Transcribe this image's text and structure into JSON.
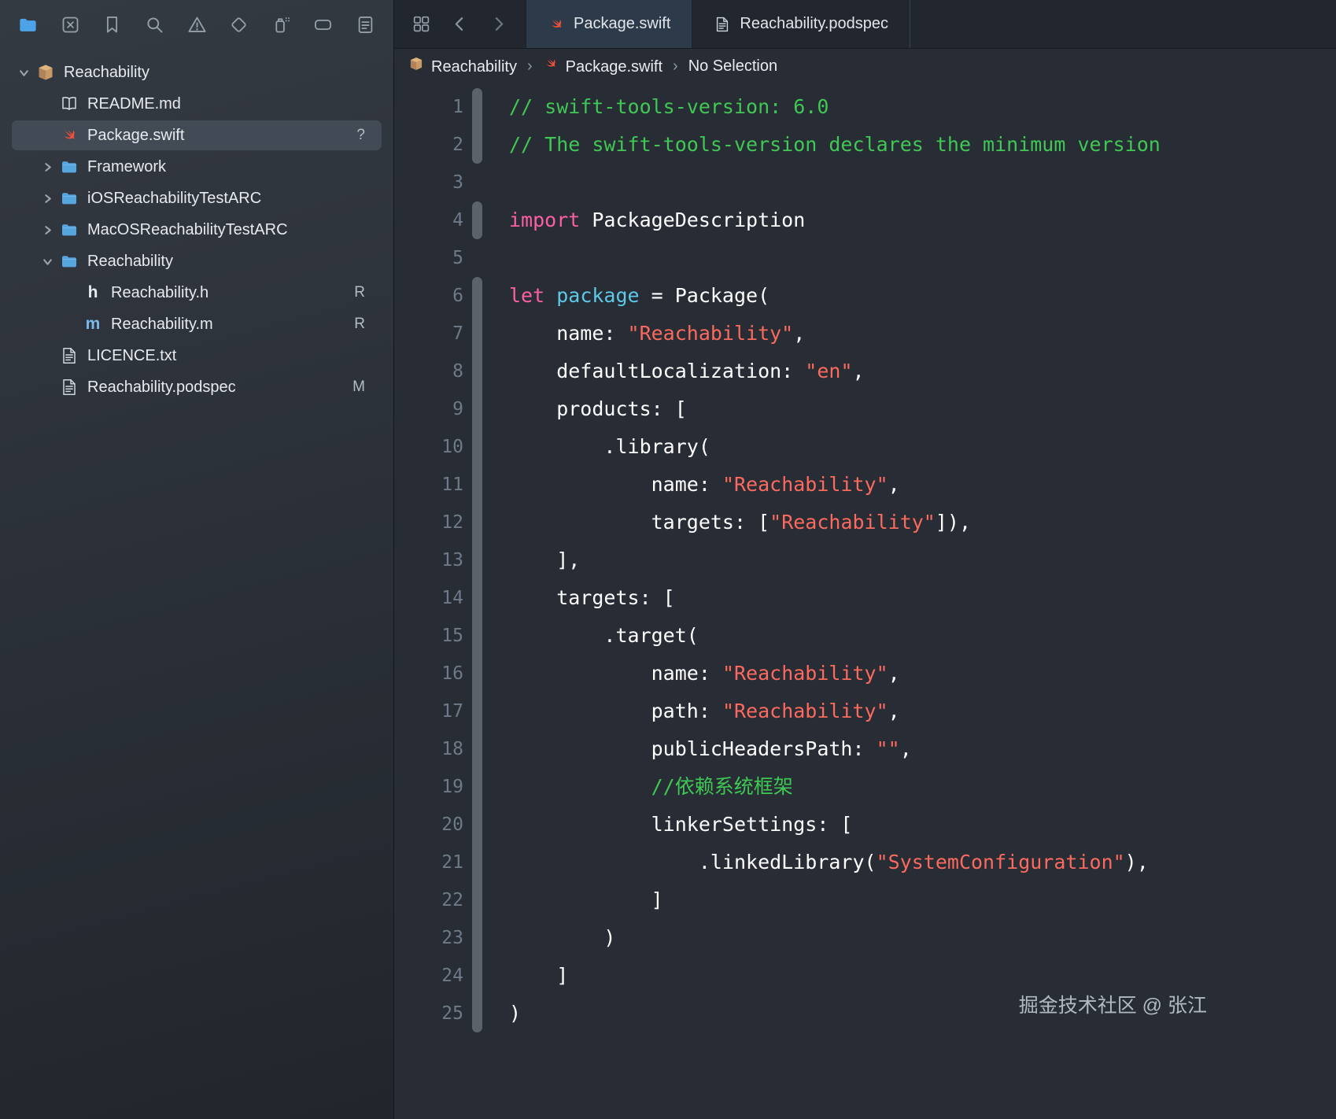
{
  "theme": {
    "editor_bg": "#272c35",
    "sidebar_bg": "#2c3139",
    "accent_blue": "#4da3e8",
    "selected_row": "#424a56",
    "comment_color": "#3fc854",
    "keyword_color": "#fc5fa3",
    "string_color": "#fc6a5d",
    "variable_color": "#5dc9e8",
    "swift_orange": "#f0513a"
  },
  "sidebar": {
    "toolbar": [
      {
        "name": "project-navigator",
        "icon": "folder-fill",
        "active": true
      },
      {
        "name": "source-control-navigator",
        "icon": "square-x",
        "active": false
      },
      {
        "name": "bookmarks-navigator",
        "icon": "bookmark",
        "active": false
      },
      {
        "name": "find-navigator",
        "icon": "magnifier",
        "active": false
      },
      {
        "name": "issues-navigator",
        "icon": "warning",
        "active": false
      },
      {
        "name": "tests-navigator",
        "icon": "diamond",
        "active": false
      },
      {
        "name": "debug-navigator",
        "icon": "spray",
        "active": false
      },
      {
        "name": "breakpoints-navigator",
        "icon": "flag",
        "active": false
      },
      {
        "name": "reports-navigator",
        "icon": "report",
        "active": false
      }
    ],
    "tree": [
      {
        "label": "Reachability",
        "icon": "package",
        "indent": 0,
        "chevron": "down",
        "badge": null,
        "selected": false
      },
      {
        "label": "README.md",
        "icon": "book",
        "indent": 1,
        "chevron": null,
        "badge": null,
        "selected": false
      },
      {
        "label": "Package.swift",
        "icon": "swift",
        "indent": 1,
        "chevron": null,
        "badge": "?",
        "selected": true
      },
      {
        "label": "Framework",
        "icon": "folder",
        "indent": 1,
        "chevron": "right",
        "badge": null,
        "selected": false
      },
      {
        "label": "iOSReachabilityTestARC",
        "icon": "folder",
        "indent": 1,
        "chevron": "right",
        "badge": null,
        "selected": false
      },
      {
        "label": "MacOSReachabilityTestARC",
        "icon": "folder",
        "indent": 1,
        "chevron": "right",
        "badge": null,
        "selected": false
      },
      {
        "label": "Reachability",
        "icon": "folder",
        "indent": 1,
        "chevron": "down",
        "badge": null,
        "selected": false
      },
      {
        "label": "Reachability.h",
        "icon": "file-h",
        "indent": 2,
        "chevron": null,
        "badge": "R",
        "selected": false
      },
      {
        "label": "Reachability.m",
        "icon": "file-m",
        "indent": 2,
        "chevron": null,
        "badge": "R",
        "selected": false
      },
      {
        "label": "LICENCE.txt",
        "icon": "doc",
        "indent": 1,
        "chevron": null,
        "badge": null,
        "selected": false
      },
      {
        "label": "Reachability.podspec",
        "icon": "doc",
        "indent": 1,
        "chevron": null,
        "badge": "M",
        "selected": false
      }
    ]
  },
  "editor": {
    "tabs": [
      {
        "label": "Package.swift",
        "icon": "swift",
        "active": true
      },
      {
        "label": "Reachability.podspec",
        "icon": "doc",
        "active": false
      }
    ],
    "breadcrumb": [
      {
        "label": "Reachability",
        "icon": "package"
      },
      {
        "label": "Package.swift",
        "icon": "swift"
      },
      {
        "label": "No Selection",
        "icon": null
      }
    ],
    "watermark": "掘金技术社区 @ 张江",
    "code": {
      "lines": [
        {
          "n": 1,
          "changed": true,
          "segs": [
            {
              "t": "// swift-tools-version: 6.0",
              "s": "comment"
            }
          ]
        },
        {
          "n": 2,
          "changed": true,
          "segs": [
            {
              "t": "// The swift-tools-version declares the minimum version",
              "s": "comment"
            }
          ]
        },
        {
          "n": 3,
          "changed": false,
          "segs": []
        },
        {
          "n": 4,
          "changed": true,
          "segs": [
            {
              "t": "import",
              "s": "keyword"
            },
            {
              "t": " PackageDescription",
              "s": "plain"
            }
          ]
        },
        {
          "n": 5,
          "changed": false,
          "segs": []
        },
        {
          "n": 6,
          "changed": true,
          "segs": [
            {
              "t": "let",
              "s": "keyword"
            },
            {
              "t": " ",
              "s": "plain"
            },
            {
              "t": "package",
              "s": "var"
            },
            {
              "t": " = Package(",
              "s": "plain"
            }
          ]
        },
        {
          "n": 7,
          "changed": true,
          "segs": [
            {
              "t": "    name: ",
              "s": "plain"
            },
            {
              "t": "\"Reachability\"",
              "s": "string"
            },
            {
              "t": ",",
              "s": "plain"
            }
          ]
        },
        {
          "n": 8,
          "changed": true,
          "segs": [
            {
              "t": "    defaultLocalization: ",
              "s": "plain"
            },
            {
              "t": "\"en\"",
              "s": "string"
            },
            {
              "t": ",",
              "s": "plain"
            }
          ]
        },
        {
          "n": 9,
          "changed": true,
          "segs": [
            {
              "t": "    products: [",
              "s": "plain"
            }
          ]
        },
        {
          "n": 10,
          "changed": true,
          "segs": [
            {
              "t": "        .library(",
              "s": "plain"
            }
          ]
        },
        {
          "n": 11,
          "changed": true,
          "segs": [
            {
              "t": "            name: ",
              "s": "plain"
            },
            {
              "t": "\"Reachability\"",
              "s": "string"
            },
            {
              "t": ",",
              "s": "plain"
            }
          ]
        },
        {
          "n": 12,
          "changed": true,
          "segs": [
            {
              "t": "            targets: [",
              "s": "plain"
            },
            {
              "t": "\"Reachability\"",
              "s": "string"
            },
            {
              "t": "]),",
              "s": "plain"
            }
          ]
        },
        {
          "n": 13,
          "changed": true,
          "segs": [
            {
              "t": "    ],",
              "s": "plain"
            }
          ]
        },
        {
          "n": 14,
          "changed": true,
          "segs": [
            {
              "t": "    targets: [",
              "s": "plain"
            }
          ]
        },
        {
          "n": 15,
          "changed": true,
          "segs": [
            {
              "t": "        .target(",
              "s": "plain"
            }
          ]
        },
        {
          "n": 16,
          "changed": true,
          "segs": [
            {
              "t": "            name: ",
              "s": "plain"
            },
            {
              "t": "\"Reachability\"",
              "s": "string"
            },
            {
              "t": ",",
              "s": "plain"
            }
          ]
        },
        {
          "n": 17,
          "changed": true,
          "segs": [
            {
              "t": "            path: ",
              "s": "plain"
            },
            {
              "t": "\"Reachability\"",
              "s": "string"
            },
            {
              "t": ",",
              "s": "plain"
            }
          ]
        },
        {
          "n": 18,
          "changed": true,
          "segs": [
            {
              "t": "            publicHeadersPath: ",
              "s": "plain"
            },
            {
              "t": "\"\"",
              "s": "string"
            },
            {
              "t": ",",
              "s": "plain"
            }
          ]
        },
        {
          "n": 19,
          "changed": true,
          "segs": [
            {
              "t": "            ",
              "s": "plain"
            },
            {
              "t": "//依赖系统框架",
              "s": "comment"
            }
          ]
        },
        {
          "n": 20,
          "changed": true,
          "segs": [
            {
              "t": "            linkerSettings: [",
              "s": "plain"
            }
          ]
        },
        {
          "n": 21,
          "changed": true,
          "segs": [
            {
              "t": "                .linkedLibrary(",
              "s": "plain"
            },
            {
              "t": "\"SystemConfiguration\"",
              "s": "string"
            },
            {
              "t": "),",
              "s": "plain"
            }
          ]
        },
        {
          "n": 22,
          "changed": true,
          "segs": [
            {
              "t": "            ]",
              "s": "plain"
            }
          ]
        },
        {
          "n": 23,
          "changed": true,
          "segs": [
            {
              "t": "        )",
              "s": "plain"
            }
          ]
        },
        {
          "n": 24,
          "changed": true,
          "segs": [
            {
              "t": "    ]",
              "s": "plain"
            }
          ]
        },
        {
          "n": 25,
          "changed": true,
          "segs": [
            {
              "t": ")",
              "s": "plain"
            }
          ]
        }
      ]
    }
  }
}
